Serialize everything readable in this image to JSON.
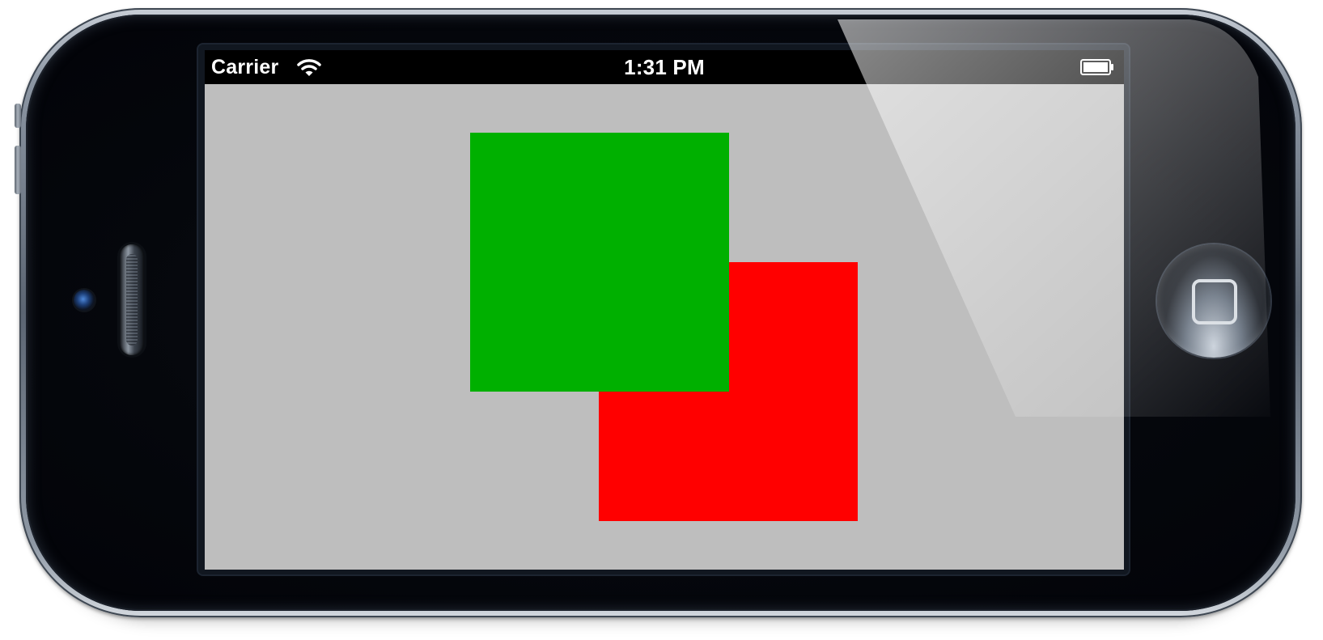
{
  "status_bar": {
    "carrier": "Carrier",
    "time": "1:31 PM",
    "wifi_icon": "wifi-icon",
    "battery_icon": "battery-icon"
  },
  "device": {
    "type": "iPhone",
    "orientation": "landscape",
    "home_button_icon": "home-button-icon"
  },
  "content": {
    "background_color": "#BEBEBE",
    "squares": [
      {
        "name": "red-square",
        "color": "#FF0000",
        "layer": "back"
      },
      {
        "name": "green-square",
        "color": "#00B000",
        "layer": "front"
      }
    ]
  }
}
